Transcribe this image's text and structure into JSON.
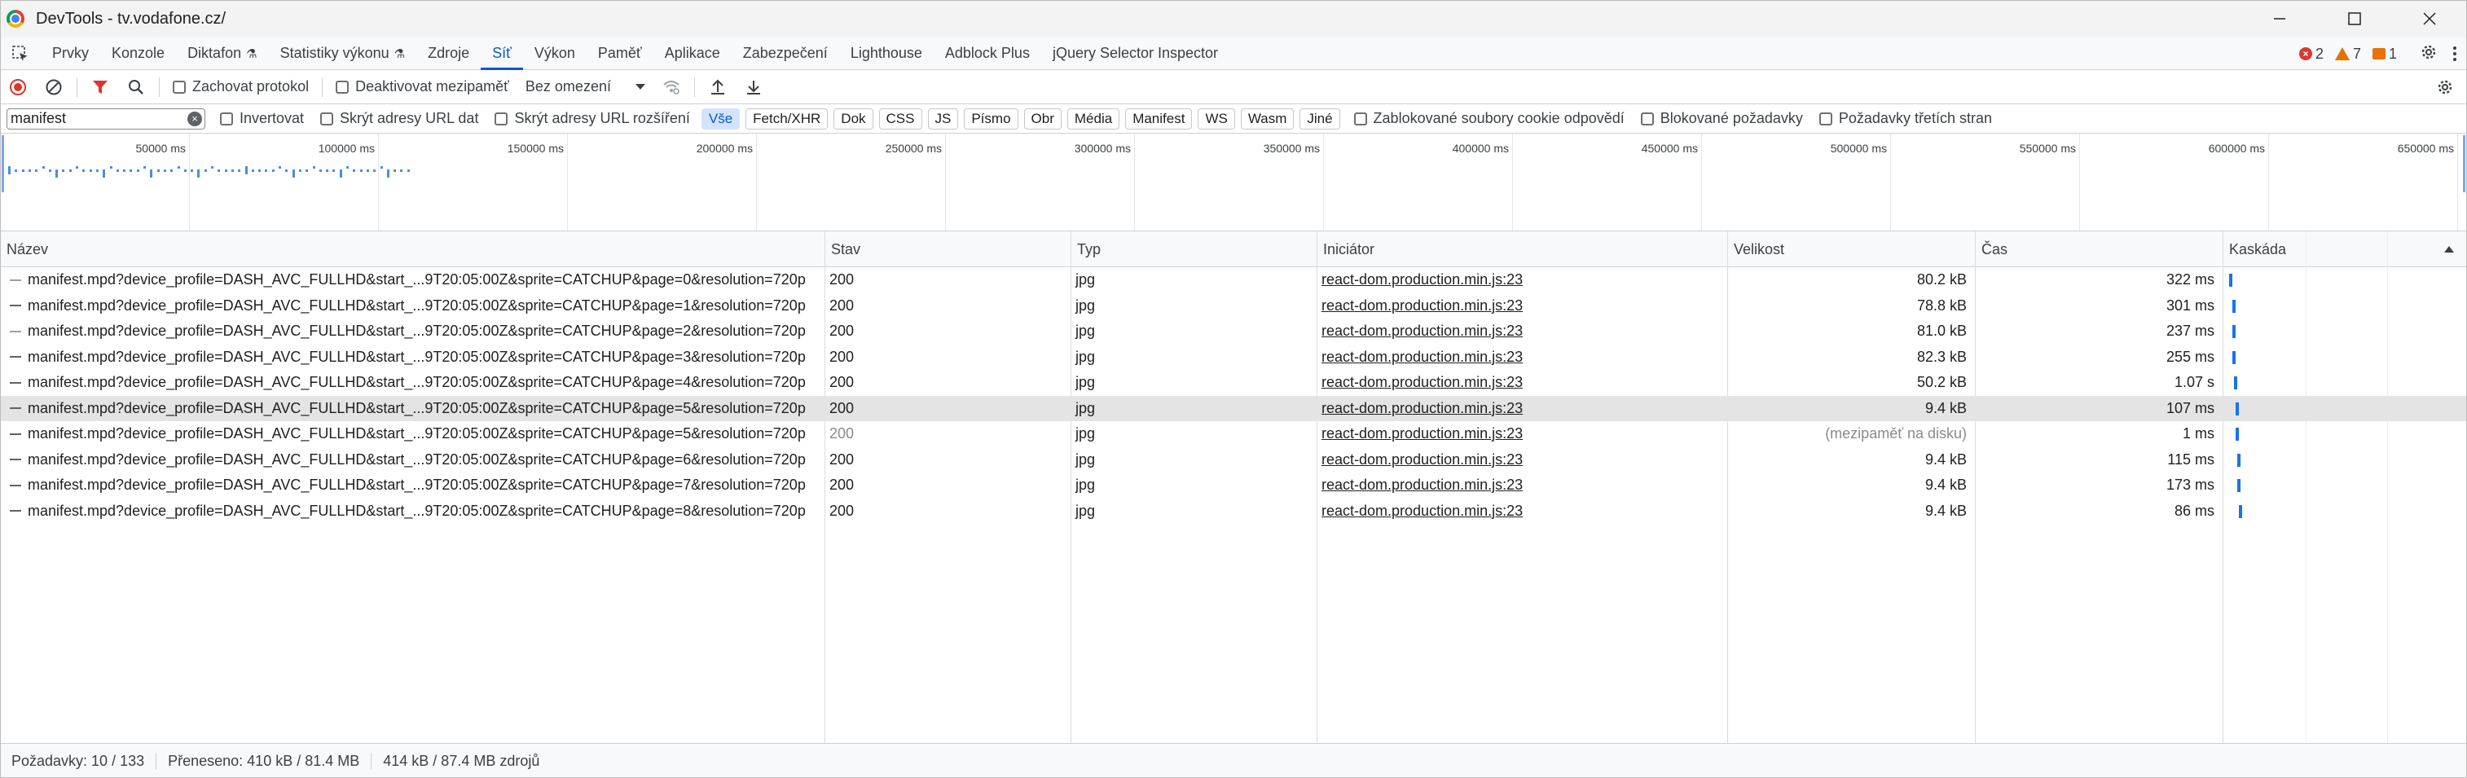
{
  "window": {
    "title": "DevTools - tv.vodafone.cz/",
    "minimize_icon": "minimize-icon",
    "maximize_icon": "maximize-icon",
    "close_icon": "close-icon"
  },
  "tabs": [
    {
      "label": "Prvky",
      "flask": false
    },
    {
      "label": "Konzole",
      "flask": false
    },
    {
      "label": "Diktafon",
      "flask": true
    },
    {
      "label": "Statistiky výkonu",
      "flask": true
    },
    {
      "label": "Zdroje",
      "flask": false
    },
    {
      "label": "Síť",
      "flask": false,
      "active": true
    },
    {
      "label": "Výkon",
      "flask": false
    },
    {
      "label": "Paměť",
      "flask": false
    },
    {
      "label": "Aplikace",
      "flask": false
    },
    {
      "label": "Zabezpečení",
      "flask": false
    },
    {
      "label": "Lighthouse",
      "flask": false
    },
    {
      "label": "Adblock Plus",
      "flask": false
    },
    {
      "label": "jQuery Selector Inspector",
      "flask": false
    }
  ],
  "flask_glyph": "⚗",
  "issues": {
    "errors": "2",
    "warnings": "7",
    "issues": "1"
  },
  "toolbar": {
    "preserve_log": "Zachovat protokol",
    "disable_cache": "Deaktivovat mezipaměť",
    "throttle": "Bez omezení"
  },
  "filter": {
    "value": "manifest",
    "invert": "Invertovat",
    "hide_data_urls": "Skrýt adresy URL dat",
    "hide_ext_urls": "Skrýt adresy URL rozšíření",
    "chips": [
      "Vše",
      "Fetch/XHR",
      "Dok",
      "CSS",
      "JS",
      "Písmo",
      "Obr",
      "Média",
      "Manifest",
      "WS",
      "Wasm",
      "Jiné"
    ],
    "blocked_cookies": "Zablokované soubory cookie odpovědí",
    "blocked_requests": "Blokované požadavky",
    "third_party": "Požadavky třetích stran"
  },
  "overview": {
    "labels": [
      "50000 ms",
      "100000 ms",
      "150000 ms",
      "200000 ms",
      "250000 ms",
      "300000 ms",
      "350000 ms",
      "400000 ms",
      "450000 ms",
      "500000 ms",
      "550000 ms",
      "600000 ms",
      "650000 ms"
    ]
  },
  "columns": {
    "name": "Název",
    "status": "Stav",
    "type": "Typ",
    "initiator": "Iniciátor",
    "size": "Velikost",
    "time": "Čas",
    "waterfall": "Kaskáda"
  },
  "rows": [
    {
      "name": "manifest.mpd?device_profile=DASH_AVC_FULLHD&start_...9T20:05:00Z&sprite=CATCHUP&page=0&resolution=720p",
      "status": "200",
      "type": "jpg",
      "initiator": "react-dom.production.min.js:23",
      "size": "80.2 kB",
      "time": "322 ms",
      "waterfall": 0.0
    },
    {
      "name": "manifest.mpd?device_profile=DASH_AVC_FULLHD&start_...9T20:05:00Z&sprite=CATCHUP&page=1&resolution=720p",
      "status": "200",
      "type": "jpg",
      "initiator": "react-dom.production.min.js:23",
      "size": "78.8 kB",
      "time": "301 ms",
      "waterfall": 0.1
    },
    {
      "name": "manifest.mpd?device_profile=DASH_AVC_FULLHD&start_...9T20:05:00Z&sprite=CATCHUP&page=2&resolution=720p",
      "status": "200",
      "type": "jpg",
      "initiator": "react-dom.production.min.js:23",
      "size": "81.0 kB",
      "time": "237 ms",
      "waterfall": 0.1
    },
    {
      "name": "manifest.mpd?device_profile=DASH_AVC_FULLHD&start_...9T20:05:00Z&sprite=CATCHUP&page=3&resolution=720p",
      "status": "200",
      "type": "jpg",
      "initiator": "react-dom.production.min.js:23",
      "size": "82.3 kB",
      "time": "255 ms",
      "waterfall": 0.1
    },
    {
      "name": "manifest.mpd?device_profile=DASH_AVC_FULLHD&start_...9T20:05:00Z&sprite=CATCHUP&page=4&resolution=720p",
      "status": "200",
      "type": "jpg",
      "initiator": "react-dom.production.min.js:23",
      "size": "50.2 kB",
      "time": "1.07 s",
      "waterfall": 0.15
    },
    {
      "name": "manifest.mpd?device_profile=DASH_AVC_FULLHD&start_...9T20:05:00Z&sprite=CATCHUP&page=5&resolution=720p",
      "status": "200",
      "type": "jpg",
      "initiator": "react-dom.production.min.js:23",
      "size": "9.4 kB",
      "time": "107 ms",
      "waterfall": 0.2,
      "selected": true
    },
    {
      "name": "manifest.mpd?device_profile=DASH_AVC_FULLHD&start_...9T20:05:00Z&sprite=CATCHUP&page=5&resolution=720p",
      "status": "200",
      "type": "jpg",
      "initiator": "react-dom.production.min.js:23",
      "size": "(mezipaměť na disku)",
      "time": "1 ms",
      "waterfall": 0.2,
      "cached": true
    },
    {
      "name": "manifest.mpd?device_profile=DASH_AVC_FULLHD&start_...9T20:05:00Z&sprite=CATCHUP&page=6&resolution=720p",
      "status": "200",
      "type": "jpg",
      "initiator": "react-dom.production.min.js:23",
      "size": "9.4 kB",
      "time": "115 ms",
      "waterfall": 0.25
    },
    {
      "name": "manifest.mpd?device_profile=DASH_AVC_FULLHD&start_...9T20:05:00Z&sprite=CATCHUP&page=7&resolution=720p",
      "status": "200",
      "type": "jpg",
      "initiator": "react-dom.production.min.js:23",
      "size": "9.4 kB",
      "time": "173 ms",
      "waterfall": 0.25
    },
    {
      "name": "manifest.mpd?device_profile=DASH_AVC_FULLHD&start_...9T20:05:00Z&sprite=CATCHUP&page=8&resolution=720p",
      "status": "200",
      "type": "jpg",
      "initiator": "react-dom.production.min.js:23",
      "size": "9.4 kB",
      "time": "86 ms",
      "waterfall": 0.3
    }
  ],
  "status": {
    "requests": "Požadavky: 10 / 133",
    "transferred": "Přeneseno: 410 kB / 81.4 MB",
    "resources": "414 kB / 87.4 MB zdrojů"
  },
  "colors": {
    "accent": "#0b57d0",
    "record": "#dc362e",
    "waterfall": "#1a73e8"
  }
}
